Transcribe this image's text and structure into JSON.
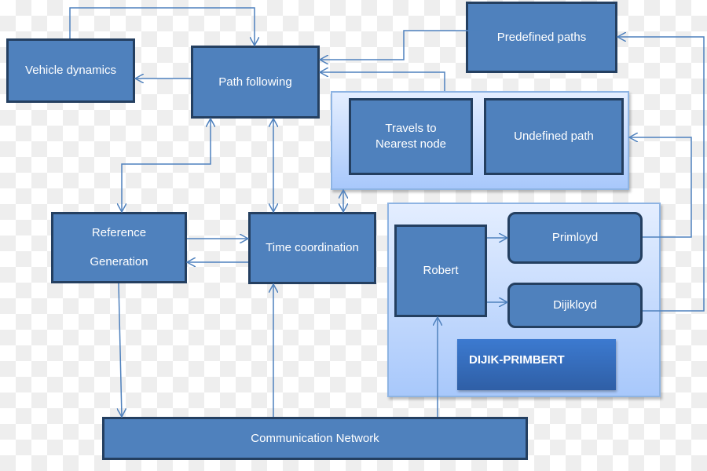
{
  "nodes": {
    "vehicle_dynamics": "Vehicle dynamics",
    "path_following": "Path following",
    "predefined_paths": "Predefined paths",
    "travels_to_nearest_node": [
      "Travels to",
      "Nearest node"
    ],
    "undefined_path": "Undefined path",
    "reference_generation": [
      "Reference",
      "Generation"
    ],
    "time_coordination": "Time coordination",
    "robert": "Robert",
    "primloyd": "Primloyd",
    "dijikloyd": "Dijikloyd",
    "dijik_primbert": "DIJIK-PRIMBERT",
    "communication_network": "Communication Network"
  },
  "colors": {
    "box_fill": "#4f81bd",
    "box_border": "#243f60",
    "connector": "#4f81bd",
    "group_fill": "#a8c8fb"
  }
}
